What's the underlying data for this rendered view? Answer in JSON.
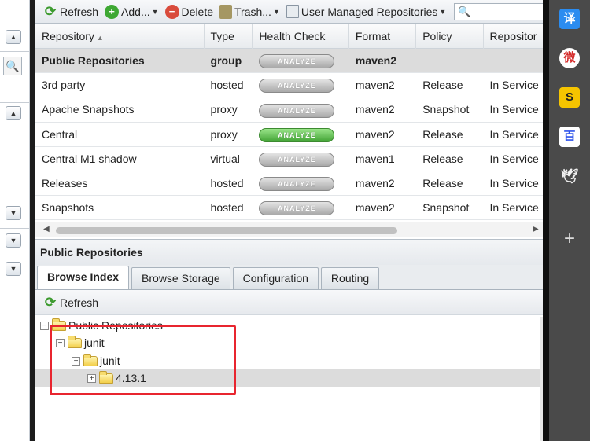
{
  "toolbar": {
    "refresh_label": "Refresh",
    "add_label": "Add...",
    "delete_label": "Delete",
    "trash_label": "Trash...",
    "repos_filter_label": "User Managed Repositories",
    "search_placeholder": ""
  },
  "grid": {
    "columns": [
      "Repository",
      "Type",
      "Health Check",
      "Format",
      "Policy",
      "Repositor"
    ],
    "analyze_label": "ANALYZE",
    "rows": [
      {
        "repository": "Public Repositories",
        "type": "group",
        "format": "maven2",
        "policy": "",
        "status": "",
        "analyze_active": false
      },
      {
        "repository": "3rd party",
        "type": "hosted",
        "format": "maven2",
        "policy": "Release",
        "status": "In Service",
        "analyze_active": false
      },
      {
        "repository": "Apache Snapshots",
        "type": "proxy",
        "format": "maven2",
        "policy": "Snapshot",
        "status": "In Service",
        "analyze_active": false
      },
      {
        "repository": "Central",
        "type": "proxy",
        "format": "maven2",
        "policy": "Release",
        "status": "In Service",
        "analyze_active": true
      },
      {
        "repository": "Central M1 shadow",
        "type": "virtual",
        "format": "maven1",
        "policy": "Release",
        "status": "In Service",
        "analyze_active": false
      },
      {
        "repository": "Releases",
        "type": "hosted",
        "format": "maven2",
        "policy": "Release",
        "status": "In Service",
        "analyze_active": false
      },
      {
        "repository": "Snapshots",
        "type": "hosted",
        "format": "maven2",
        "policy": "Snapshot",
        "status": "In Service",
        "analyze_active": false
      }
    ]
  },
  "detail": {
    "title": "Public Repositories",
    "tabs": [
      "Browse Index",
      "Browse Storage",
      "Configuration",
      "Routing"
    ],
    "refresh_label": "Refresh",
    "tree": [
      {
        "label": "Public Repositories",
        "toggle": "−",
        "level": 0
      },
      {
        "label": "junit",
        "toggle": "−",
        "level": 1
      },
      {
        "label": "junit",
        "toggle": "−",
        "level": 2
      },
      {
        "label": "4.13.1",
        "toggle": "+",
        "level": 3
      }
    ]
  },
  "sidebar_right": {
    "translate_glyph": "译",
    "weibo_glyph": "微",
    "sogou_glyph": "S",
    "baidu_glyph": "百",
    "bird_glyph": "🕊",
    "plus_glyph": "+"
  },
  "colors": {
    "analyze_active": "#43a436",
    "analyze_inactive": "#a9a9a9",
    "highlight_box": "#e8252f",
    "selected_row": "#dcdcdc",
    "browser_sidebar": "#4a4a4a"
  }
}
